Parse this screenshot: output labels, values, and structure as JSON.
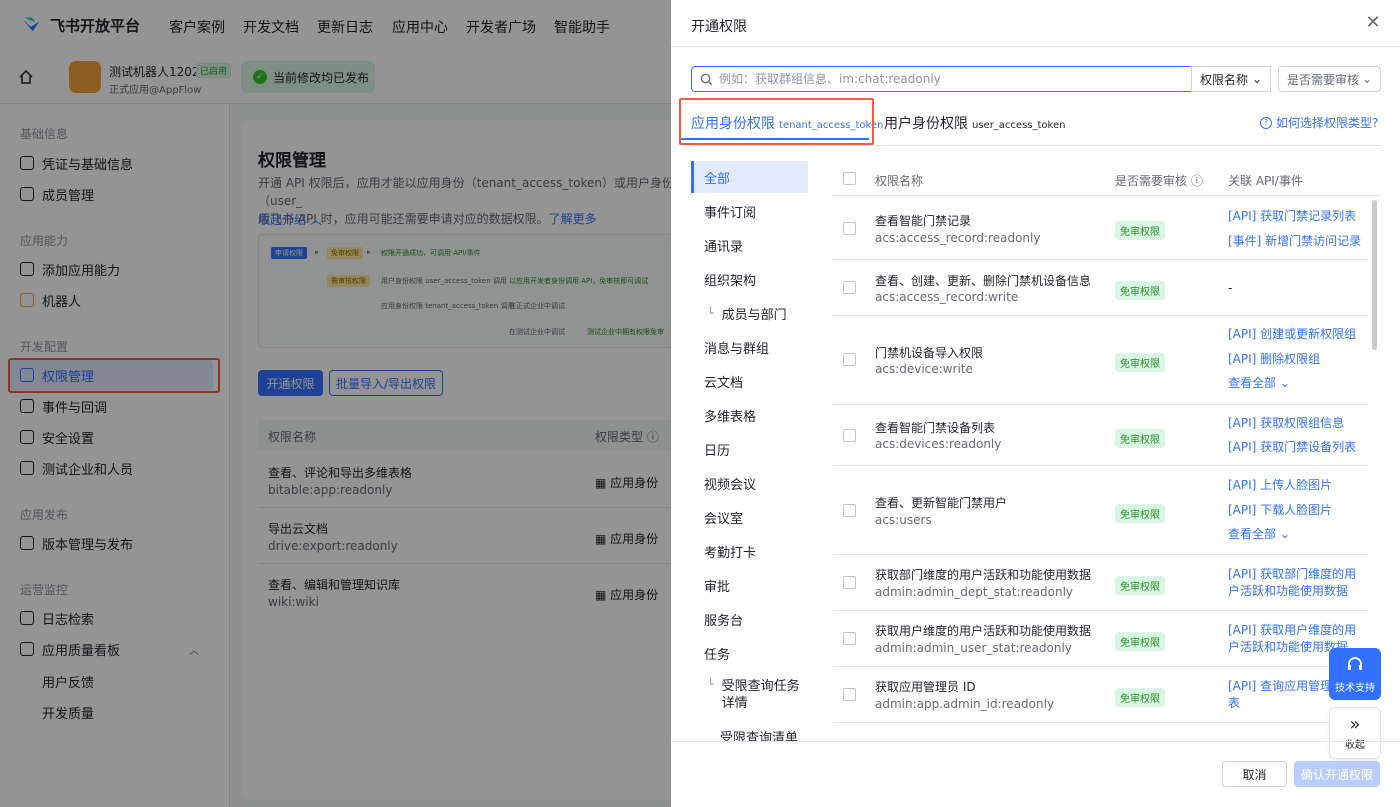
{
  "brand": {
    "name": "飞书开放平台"
  },
  "topnav": [
    "客户案例",
    "开发文档",
    "更新日志",
    "应用中心",
    "开发者广场",
    "智能助手"
  ],
  "app": {
    "name": "测试机器人1202",
    "status": "已启用",
    "subtitle": "正式应用@AppFlow"
  },
  "publish_banner": "当前修改均已发布",
  "sidebar": {
    "groups": [
      {
        "label": "基础信息",
        "items": [
          "凭证与基础信息",
          "成员管理"
        ]
      },
      {
        "label": "应用能力",
        "items": [
          "添加应用能力",
          "机器人"
        ]
      },
      {
        "label": "开发配置",
        "items": [
          "权限管理",
          "事件与回调",
          "安全设置",
          "测试企业和人员"
        ]
      },
      {
        "label": "应用发布",
        "items": [
          "版本管理与发布"
        ]
      },
      {
        "label": "运营监控",
        "items": [
          "日志检索",
          "应用质量看板"
        ]
      }
    ],
    "subitems": [
      "用户反馈",
      "开发质量"
    ],
    "active": "权限管理"
  },
  "main": {
    "title": "权限管理",
    "desc1": "开通 API 权限后，应用才能以应用身份（tenant_access_token）或用户身份（user_",
    "desc2": "用飞书 API 时，应用可能还需要申请对应的数据权限。",
    "learn_more": "了解更多",
    "collapse": "收起介绍",
    "flow": {
      "step1": "申请权限",
      "free": "免审权限",
      "free_result": "权限开通成功，可调用 API/事件",
      "review": "需审核权限",
      "user_perm": "用户身份权限 user_access_token 调用",
      "user_result": "以应用开发者身份调用 API，免审核即可调试",
      "app_perm": "应用身份权限 tenant_access_token 调用",
      "prod": "在正式企业中调试",
      "test": "在测试企业中调试",
      "test_result": "测试企业中拥有权限免审"
    },
    "btn_open": "开通权限",
    "btn_batch": "批量导入/导出权限",
    "table": {
      "headers": [
        "权限名称",
        "权限类型 ⓘ"
      ],
      "rows": [
        {
          "name": "查看、评论和导出多维表格",
          "code": "bitable:app:readonly",
          "type": "应用身份"
        },
        {
          "name": "导出云文档",
          "code": "drive:export:readonly",
          "type": "应用身份"
        },
        {
          "name": "查看、编辑和管理知识库",
          "code": "wiki:wiki",
          "type": "应用身份"
        }
      ]
    }
  },
  "panel": {
    "title": "开通权限",
    "search_placeholder": "例如：获取群组信息、im:chat:readonly",
    "filter1": "权限名称",
    "filter2": "是否需要审核",
    "tabs": [
      {
        "label": "应用身份权限",
        "token": "tenant_access_token"
      },
      {
        "label": "用户身份权限",
        "token": "user_access_token"
      }
    ],
    "help": "如何选择权限类型?",
    "categories": [
      "全部",
      "事件订阅",
      "通讯录",
      "组织架构",
      "成员与部门",
      "消息与群组",
      "云文档",
      "多维表格",
      "日历",
      "视频会议",
      "会议室",
      "考勤打卡",
      "审批",
      "服务台",
      "任务",
      "受限查询任务详情",
      "受限查询清单详"
    ],
    "headers": {
      "name": "权限名称",
      "review": "是否需要审核 ⓘ",
      "api": "关联 API/事件"
    },
    "rows": [
      {
        "name": "查看智能门禁记录",
        "code": "acs:access_record:readonly",
        "tag": "免审权限",
        "apis": [
          "[API] 获取门禁记录列表",
          "[事件] 新增门禁访问记录"
        ]
      },
      {
        "name": "查看、创建、更新、删除门禁机设备信息",
        "code": "acs:access_record:write",
        "tag": "免审权限",
        "apis": [
          "-"
        ]
      },
      {
        "name": "门禁机设备导入权限",
        "code": "acs:device:write",
        "tag": "免审权限",
        "apis": [
          "[API] 创建或更新权限组",
          "[API] 删除权限组",
          "查看全部 ⌄"
        ]
      },
      {
        "name": "查看智能门禁设备列表",
        "code": "acs:devices:readonly",
        "tag": "免审权限",
        "apis": [
          "[API] 获取权限组信息",
          "[API] 获取门禁设备列表"
        ]
      },
      {
        "name": "查看、更新智能门禁用户",
        "code": "acs:users",
        "tag": "免审权限",
        "apis": [
          "[API] 上传人脸图片",
          "[API] 下载人脸图片",
          "查看全部 ⌄"
        ]
      },
      {
        "name": "获取部门维度的用户活跃和功能使用数据",
        "code": "admin:admin_dept_stat:readonly",
        "tag": "免审权限",
        "apis": [
          "[API] 获取部门维度的用",
          "户活跃和功能使用数据"
        ]
      },
      {
        "name": "获取用户维度的用户活跃和功能使用数据",
        "code": "admin:admin_user_stat:readonly",
        "tag": "免审权限",
        "apis": [
          "[API] 获取用户维度的用",
          "户活跃和功能使用数据"
        ]
      },
      {
        "name": "获取应用管理员 ID",
        "code": "admin:app.admin_id:readonly",
        "tag": "免审权限",
        "apis": [
          "[API] 查询应用管理",
          "表"
        ]
      }
    ],
    "support": "技术支持",
    "collapse": "收起",
    "cancel": "取消",
    "confirm": "确认开通权限"
  },
  "colors": {
    "accent": "#3370ff",
    "highlight": "#f05b41",
    "tag_green": "#2a8d26"
  }
}
